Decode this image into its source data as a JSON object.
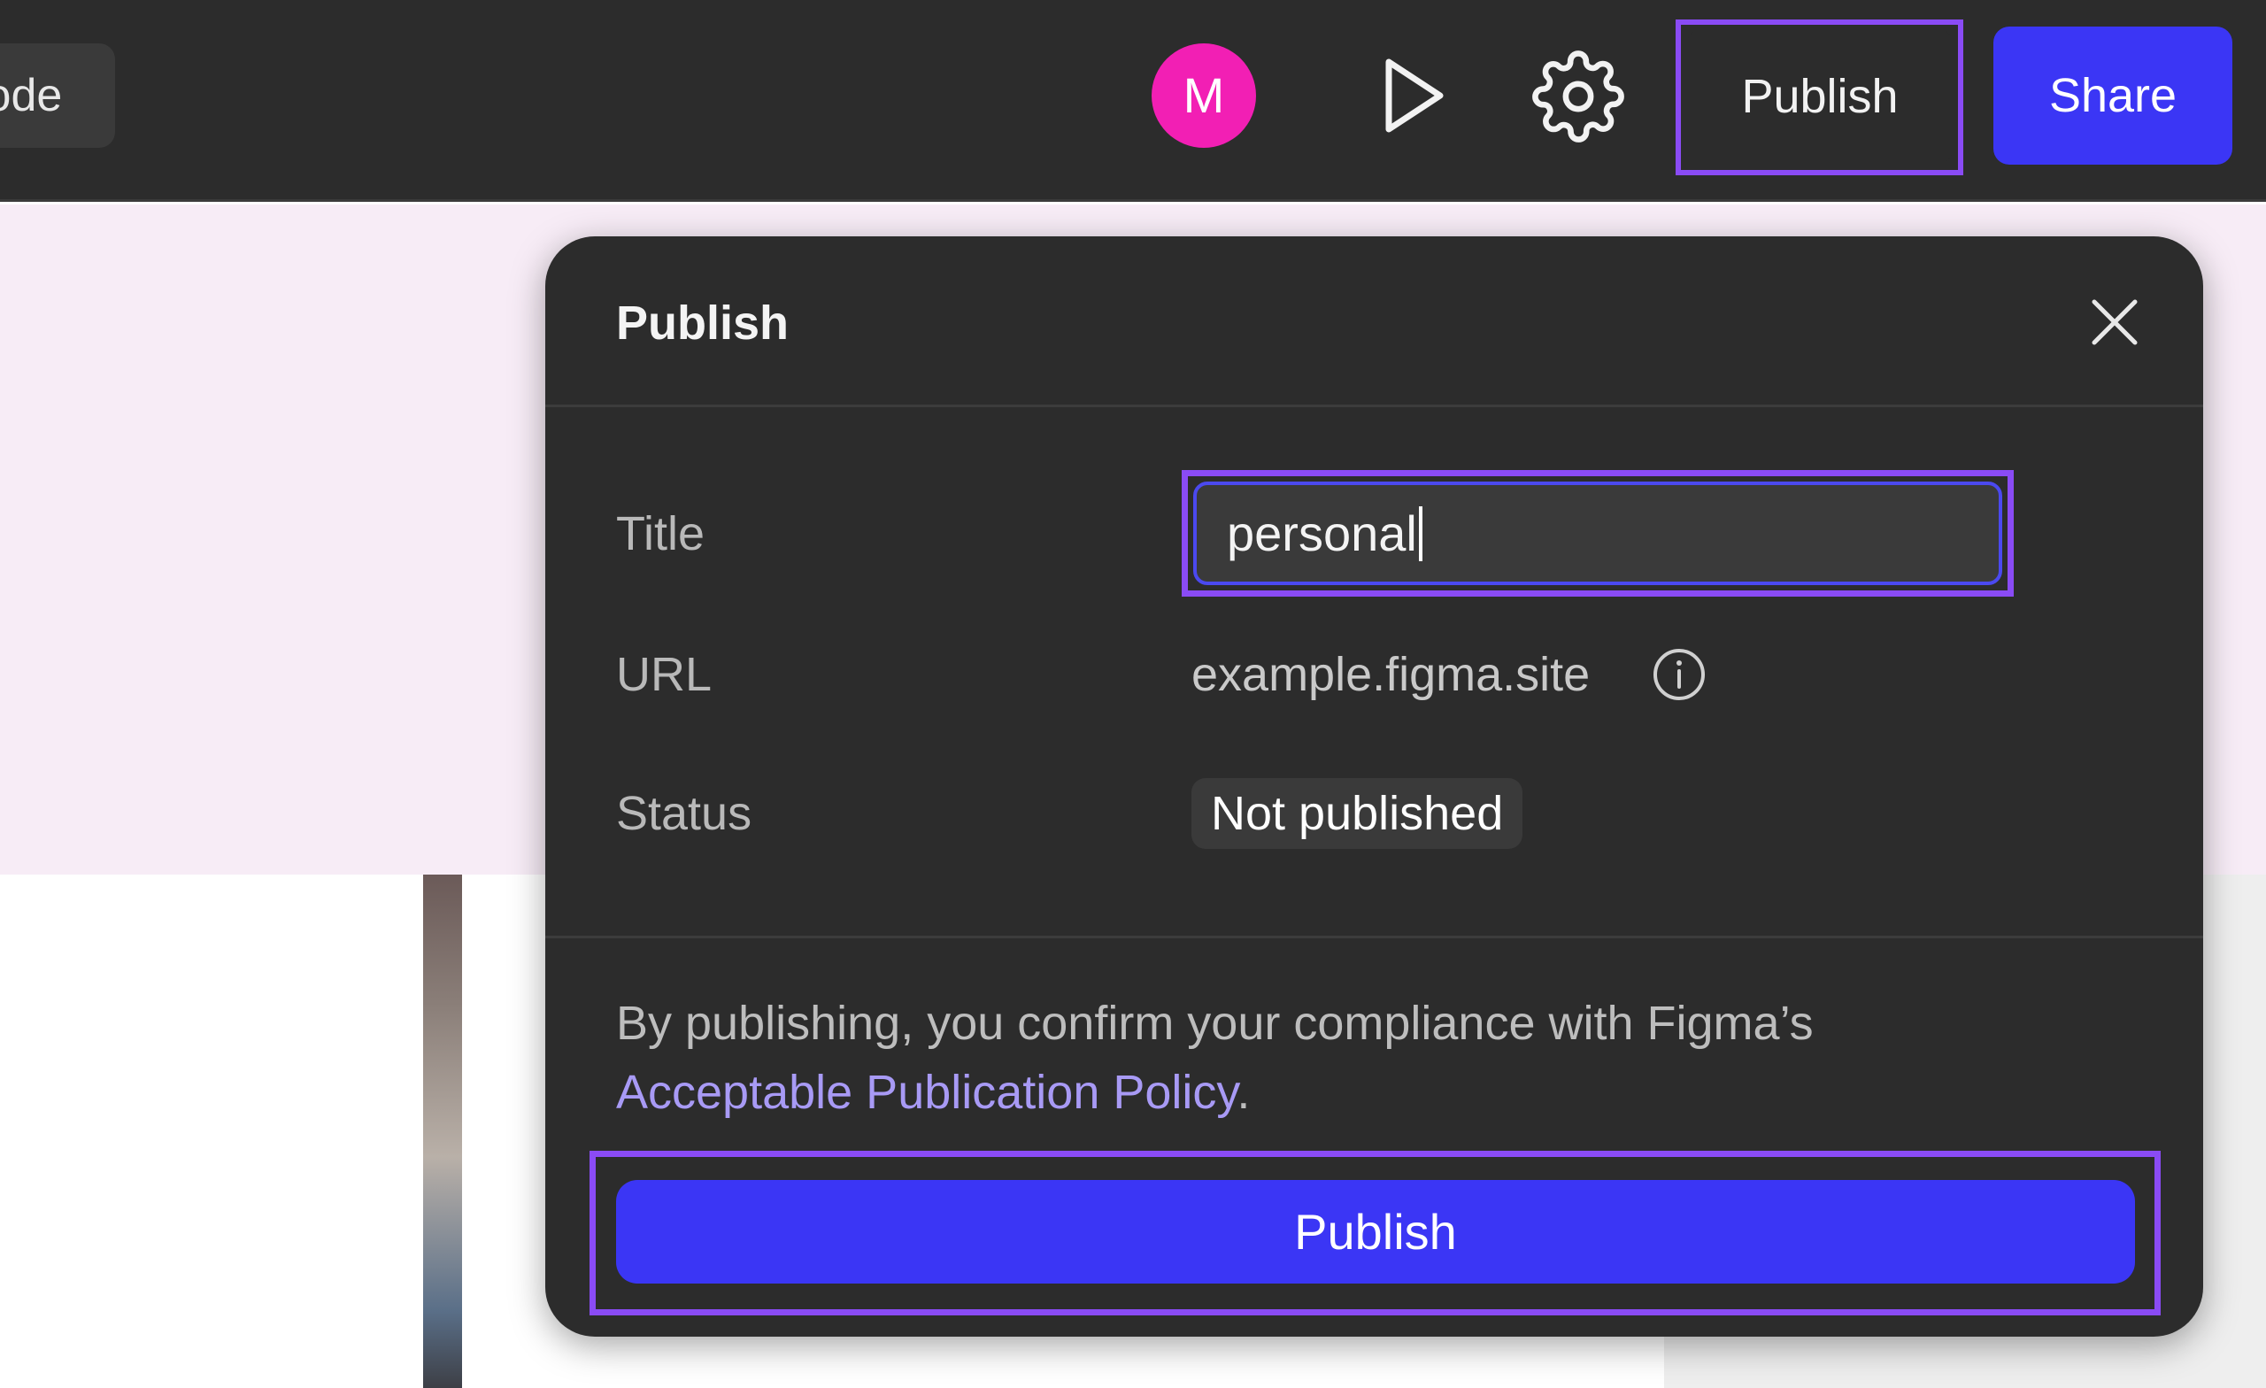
{
  "toolbar": {
    "mode_label": "Code",
    "avatar_initial": "M",
    "publish_label": "Publish",
    "share_label": "Share"
  },
  "dialog": {
    "title": "Publish",
    "fields": {
      "title_label": "Title",
      "title_value": "personal",
      "url_label": "URL",
      "url_value": "example.figma.site",
      "status_label": "Status",
      "status_value": "Not published"
    },
    "compliance_text": "By publishing, you confirm your compliance with Figma’s ",
    "policy_link": "Acceptable Publication Policy",
    "compliance_end": ".",
    "publish_button": "Publish"
  },
  "colors": {
    "toolbar_bg": "#2c2c2c",
    "dialog_bg": "#2c2c2c",
    "accent": "#3b36f5",
    "avatar": "#f21fb4",
    "highlight": "#8a4bf5",
    "link": "#a89af5",
    "canvas_pink": "#f7ecf6"
  },
  "icons": [
    "play-icon",
    "gear-icon",
    "close-icon",
    "info-icon"
  ]
}
